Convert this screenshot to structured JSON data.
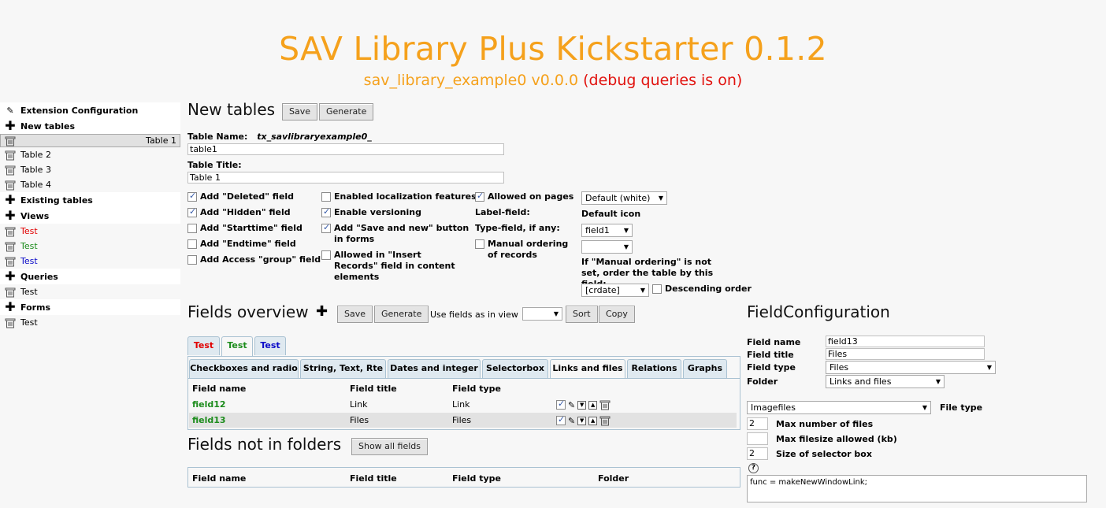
{
  "header": {
    "title": "SAV Library Plus Kickstarter 0.1.2",
    "subtitle": "sav_library_example0 v0.0.0",
    "debug": "(debug queries is on)"
  },
  "sidebar": {
    "items": [
      {
        "label": "Extension Configuration",
        "icon": "pencil-icon",
        "kind": "section"
      },
      {
        "label": "New tables",
        "icon": "plus-icon",
        "kind": "section"
      },
      {
        "label": "Table 1",
        "icon": "trash-icon",
        "kind": "item",
        "selected": true
      },
      {
        "label": "Table 2",
        "icon": "trash-icon",
        "kind": "item"
      },
      {
        "label": "Table 3",
        "icon": "trash-icon",
        "kind": "item"
      },
      {
        "label": "Table 4",
        "icon": "trash-icon",
        "kind": "item"
      },
      {
        "label": "Existing tables",
        "icon": "plus-icon",
        "kind": "section"
      },
      {
        "label": "Views",
        "icon": "plus-icon",
        "kind": "section"
      },
      {
        "label": "Test",
        "icon": "trash-icon",
        "kind": "item",
        "color": "red"
      },
      {
        "label": "Test",
        "icon": "trash-icon",
        "kind": "item",
        "color": "green"
      },
      {
        "label": "Test",
        "icon": "trash-icon",
        "kind": "item",
        "color": "blue"
      },
      {
        "label": "Queries",
        "icon": "plus-icon",
        "kind": "section"
      },
      {
        "label": "Test",
        "icon": "trash-icon",
        "kind": "item"
      },
      {
        "label": "Forms",
        "icon": "plus-icon",
        "kind": "section"
      },
      {
        "label": "Test",
        "icon": "trash-icon",
        "kind": "item"
      }
    ]
  },
  "new_tables": {
    "heading": "New tables",
    "save": "Save",
    "generate": "Generate",
    "table_name_label": "Table Name:",
    "table_name_prefix": "tx_savlibraryexample0_",
    "table_name_value": "table1",
    "table_title_label": "Table Title:",
    "table_title_value": "Table 1",
    "col1": {
      "deleted": "Add \"Deleted\" field",
      "hidden": "Add \"Hidden\" field",
      "starttime": "Add \"Starttime\" field",
      "endtime": "Add \"Endtime\" field",
      "access": "Add Access \"group\" field"
    },
    "col2": {
      "localization": "Enabled localization features",
      "versioning": "Enable versioning",
      "save_new": "Add \"Save and new\" button in forms",
      "insert_records": "Allowed in \"Insert Records\" field in content elements"
    },
    "col3": {
      "allowed_pages": "Allowed on pages",
      "label_field": "Label-field:",
      "type_field": "Type-field, if any:",
      "manual_ordering": "Manual ordering of records"
    },
    "col4": {
      "icon_select": "Default (white)",
      "default_icon": "Default icon",
      "label_field_select": "field1",
      "type_field_select": "",
      "ordering_note": "If \"Manual ordering\" is not set, order the table by this field:",
      "order_select": "[crdate]",
      "descending": "Descending order"
    }
  },
  "fields_overview": {
    "heading": "Fields overview",
    "save": "Save",
    "generate": "Generate",
    "use_fields_label": "Use fields as in view",
    "use_fields_value": "",
    "sort": "Sort",
    "copy": "Copy",
    "view_tabs": [
      {
        "label": "Test",
        "color": "#e10000"
      },
      {
        "label": "Test",
        "color": "#1c8c1c"
      },
      {
        "label": "Test",
        "color": "#0a0ac8"
      }
    ],
    "folder_tabs": [
      "Checkboxes and radio",
      "String, Text, Rte",
      "Dates and integer",
      "Selectorbox",
      "Links and files",
      "Relations",
      "Graphs"
    ],
    "columns": [
      "Field name",
      "Field title",
      "Field type"
    ],
    "rows": [
      {
        "name": "field12",
        "title": "Link",
        "type": "Link"
      },
      {
        "name": "field13",
        "title": "Files",
        "type": "Files"
      }
    ]
  },
  "fields_not_in_folders": {
    "heading": "Fields not in folders",
    "show_all": "Show all fields",
    "columns": [
      "Field name",
      "Field title",
      "Field type",
      "Folder"
    ]
  },
  "field_config": {
    "heading": "FieldConfiguration",
    "name_label": "Field name",
    "name_value": "field13",
    "title_label": "Field title",
    "title_value": "Files",
    "type_label": "Field type",
    "type_value": "Files",
    "folder_label": "Folder",
    "folder_value": "Links and files",
    "file_type_select": "Imagefiles",
    "file_type_label": "File type",
    "max_files_value": "2",
    "max_files_label": "Max number of files",
    "max_size_value": "",
    "max_size_label": "Max filesize allowed (kb)",
    "selector_size_value": "2",
    "selector_size_label": "Size of selector box",
    "help": "?",
    "textarea": "func = makeNewWindowLink;"
  }
}
